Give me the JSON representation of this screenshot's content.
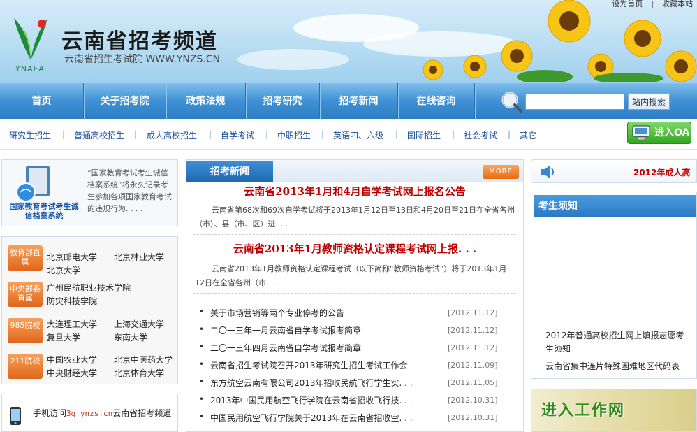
{
  "header": {
    "top_links": [
      "设为首页",
      "|",
      "收藏本站"
    ],
    "logo_text": "YNAEA",
    "site_title": "云南省招考频道",
    "site_subtitle": "云南省招生考试院 WWW.YNZS.CN"
  },
  "nav": {
    "items": [
      "首页",
      "关于招考院",
      "政策法规",
      "招考研究",
      "招考新闻",
      "在线咨询"
    ],
    "search_placeholder": "",
    "search_button": "站内搜索"
  },
  "subnav": {
    "items": [
      "研究生招生",
      "普通高校招生",
      "成人高校招生",
      "自学考试",
      "中职招生",
      "英语四、六级",
      "国际招生",
      "社会考试",
      "其它"
    ],
    "oa_button": "进入OA"
  },
  "credit": {
    "caption": "国家教育考试考生诚信档案系统",
    "description": "“国家教育考试考生诚信档案系统”将永久记录考生参加各项国家教育考试的违规行为. . . ."
  },
  "schools": [
    {
      "tag": "教育部直属",
      "names": [
        "北京邮电大学",
        "北京林业大学",
        "北京大学"
      ]
    },
    {
      "tag": "中央部委直属",
      "names": [
        "广州民航职业技术学院",
        "防灾科技学院"
      ]
    },
    {
      "tag": "985院校",
      "names": [
        "大连理工大学",
        "上海交通大学",
        "复旦大学",
        "东南大学"
      ]
    },
    {
      "tag": "211院校",
      "names": [
        "中国农业大学",
        "北京中医药大学",
        "中央财经大学",
        "北京体育大学"
      ]
    }
  ],
  "mobile": {
    "prefix": "手机访问",
    "url": "3g.ynzs.cn",
    "suffix": "云南省招考频道"
  },
  "news": {
    "tab": "招考新闻",
    "more": "MORE",
    "headlines": [
      {
        "title": "云南省2013年1月和4月自学考试网上报名公告",
        "summary": "云南省第68次和69次自学考试将于2013年1月12日至13日和4月20日至21日在全省各州（市）、县（市、区）进. . ."
      },
      {
        "title": "云南省2013年1月教师资格认定课程考试网上报. . .",
        "summary": "云南省2013年1月教师资格认定课程考试（以下简称“教师资格考试”）将于2013年1月12日在全省各州（市. . ."
      }
    ],
    "items": [
      {
        "title": "关于市场营销等两个专业停考的公告",
        "date": "[2012.11.12]"
      },
      {
        "title": "二〇一三年一月云南省自学考试报考简章",
        "date": "[2012.11.12]"
      },
      {
        "title": "二〇一三年四月云南省自学考试报考简章",
        "date": "[2012.11.12]"
      },
      {
        "title": "云南省招生考试院召开2013年研究生招生考试工作会",
        "date": "[2012.11.09]"
      },
      {
        "title": "东方航空云南有限公司2013年招收民航飞行学生实. . .",
        "date": "[2012.11.05]"
      },
      {
        "title": "2013年中国民用航空飞行学院在云南省招收飞行技. . .",
        "date": "[2012.10.31]"
      },
      {
        "title": "中国民用航空飞行学院关于2013年在云南省招收空. . .",
        "date": "[2012.10.31]"
      }
    ]
  },
  "notice": {
    "marquee": "2012年成人高"
  },
  "kszx": {
    "title": "考生须知",
    "items": [
      "2012年普通高校招生网上填报志愿考生须知",
      "云南省集中连片特殊困难地区代码表"
    ]
  },
  "work": {
    "label": "进入工作网"
  },
  "colors": {
    "nav_blue": "#2e7ec5",
    "headline_red": "#c00000",
    "tag_orange": "#e0661c",
    "link_blue": "#1a4f9c"
  }
}
